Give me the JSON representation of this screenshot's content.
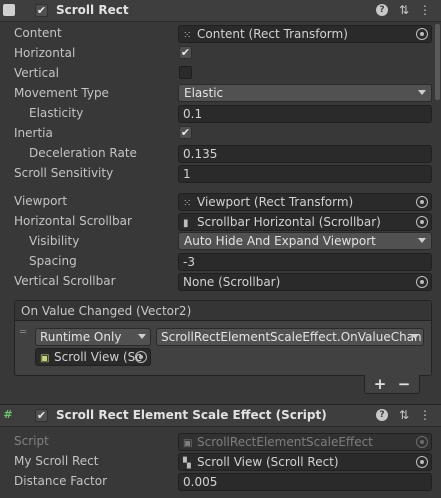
{
  "scroll_rect": {
    "title": "Scroll Rect",
    "enabled": true,
    "fields": {
      "content_label": "Content",
      "content_value": "Content (Rect Transform)",
      "horizontal_label": "Horizontal",
      "vertical_label": "Vertical",
      "movement_type_label": "Movement Type",
      "movement_type_value": "Elastic",
      "elasticity_label": "Elasticity",
      "elasticity_value": "0.1",
      "inertia_label": "Inertia",
      "deceleration_label": "Deceleration Rate",
      "deceleration_value": "0.135",
      "sensitivity_label": "Scroll Sensitivity",
      "sensitivity_value": "1",
      "viewport_label": "Viewport",
      "viewport_value": "Viewport (Rect Transform)",
      "hscroll_label": "Horizontal Scrollbar",
      "hscroll_value": "Scrollbar Horizontal (Scrollbar)",
      "visibility_label": "Visibility",
      "visibility_value": "Auto Hide And Expand Viewport",
      "spacing_label": "Spacing",
      "spacing_value": "-3",
      "vscroll_label": "Vertical Scrollbar",
      "vscroll_value": "None (Scrollbar)"
    },
    "event": {
      "header": "On Value Changed (Vector2)",
      "runtime_value": "Runtime Only",
      "function_value": "ScrollRectElementScaleEffect.OnValueChan",
      "target_value": "Scroll View (Sc",
      "add_label": "+",
      "remove_label": "−"
    }
  },
  "scale_effect": {
    "title": "Scroll Rect Element Scale Effect (Script)",
    "enabled": true,
    "script_label": "Script",
    "script_value": "ScrollRectElementScaleEffect",
    "my_scroll_rect_label": "My Scroll Rect",
    "my_scroll_rect_value": "Scroll View (Scroll Rect)",
    "distance_factor_label": "Distance Factor",
    "distance_factor_value": "0.005"
  },
  "header_icons": {
    "help": "?",
    "presets": "⇅",
    "menu": "⋮"
  }
}
